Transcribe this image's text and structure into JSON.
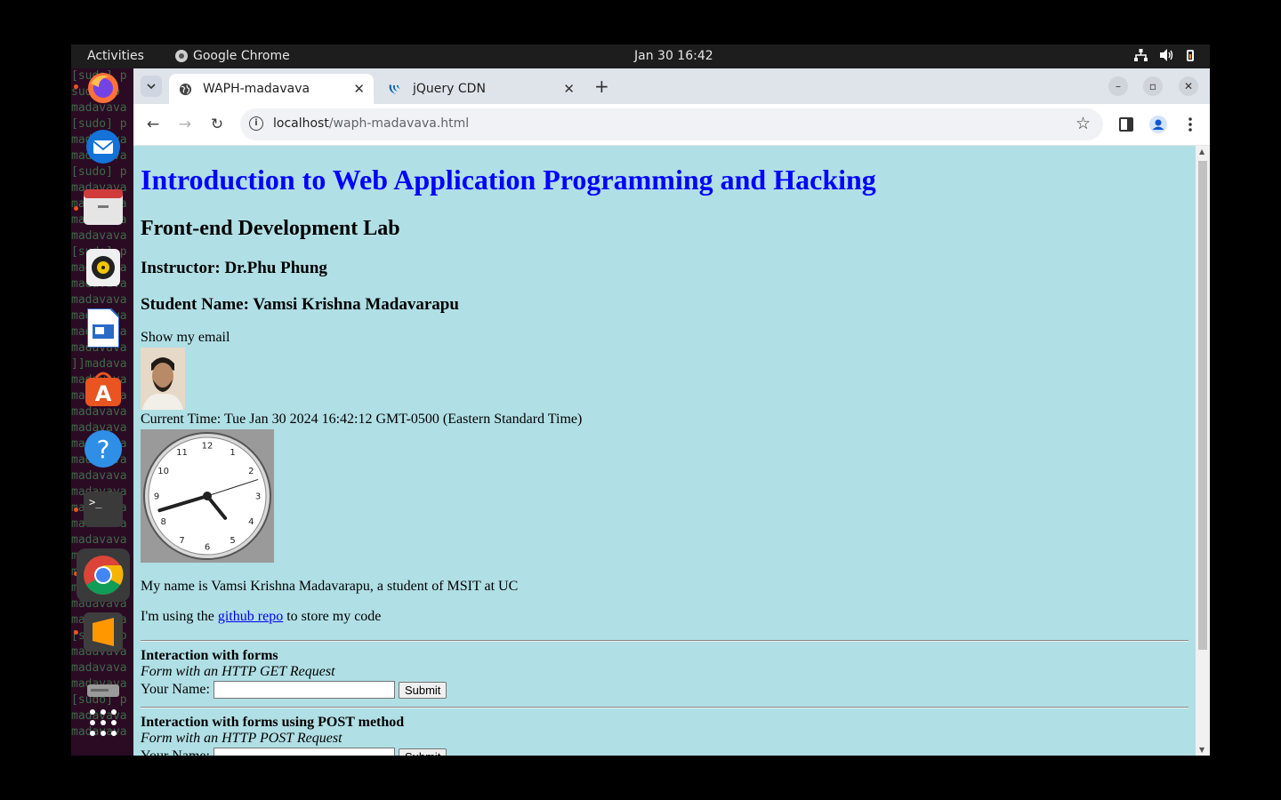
{
  "topbar": {
    "activities": "Activities",
    "app_name": "Google Chrome",
    "datetime": "Jan 30  16:42"
  },
  "terminal_bg": {
    "lines": [
      "[sudo] p",
      "sudo] p",
      "madavava",
      "[sudo] p",
      "madavava",
      "madavava",
      "[sudo] p",
      "madavava",
      "madavava",
      "madavava",
      "madavava",
      "[sudo] p",
      "madavava",
      "madavava",
      "madavava",
      "madavava",
      "madavava",
      "madavava",
      "]]madava",
      "madavava",
      "madavava",
      "madavava",
      "madavava",
      "madavava",
      "madavava",
      "madavava",
      "madavava",
      "madavava",
      "madavava",
      "madavava",
      "madavava",
      "madavava",
      "madavava",
      "madavava",
      "madavava",
      "[sudo] p",
      "madavava",
      "madavava",
      "madavava",
      "[sudo] p",
      "madavava",
      "madavava"
    ]
  },
  "dock": {
    "items": [
      "firefox-icon",
      "thunderbird-icon",
      "files-icon",
      "rhythmbox-icon",
      "writer-icon",
      "app-center-icon",
      "help-icon",
      "terminal-icon",
      "chrome-icon",
      "sublime-icon",
      "disk-icon",
      "show-apps-icon"
    ]
  },
  "browser": {
    "tabs": [
      {
        "title": "WAPH-madavava",
        "active": true
      },
      {
        "title": "jQuery CDN",
        "active": false
      }
    ],
    "url_host": "localhost",
    "url_path": "/waph-madavava.html"
  },
  "page": {
    "h1": "Introduction to Web Application Programming and Hacking",
    "h2": "Front-end Development Lab",
    "instructor": "Instructor: Dr.Phu Phung",
    "student": "Student Name: Vamsi Krishna Madavarapu",
    "show_email": "Show my email",
    "current_time": "Current Time: Tue Jan 30 2024 16:42:12 GMT-0500 (Eastern Standard Time)",
    "clock_numbers": [
      "12",
      "1",
      "2",
      "3",
      "4",
      "5",
      "6",
      "7",
      "8",
      "9",
      "10",
      "11"
    ],
    "my_name": "My name is Vamsi Krishna Madavarapu, a student of MSIT at UC",
    "repo_prefix": "I'm using the ",
    "repo_link": "github repo",
    "repo_suffix": " to store my code",
    "form_get": {
      "title": "Interaction with forms",
      "subtitle": "Form with an HTTP GET Request",
      "label": "Your Name:",
      "value": "",
      "button": "Submit"
    },
    "form_post": {
      "title": "Interaction with forms using POST method",
      "subtitle": "Form with an HTTP POST Request",
      "label": "Your Name:",
      "value": "",
      "button": "Submit"
    }
  }
}
